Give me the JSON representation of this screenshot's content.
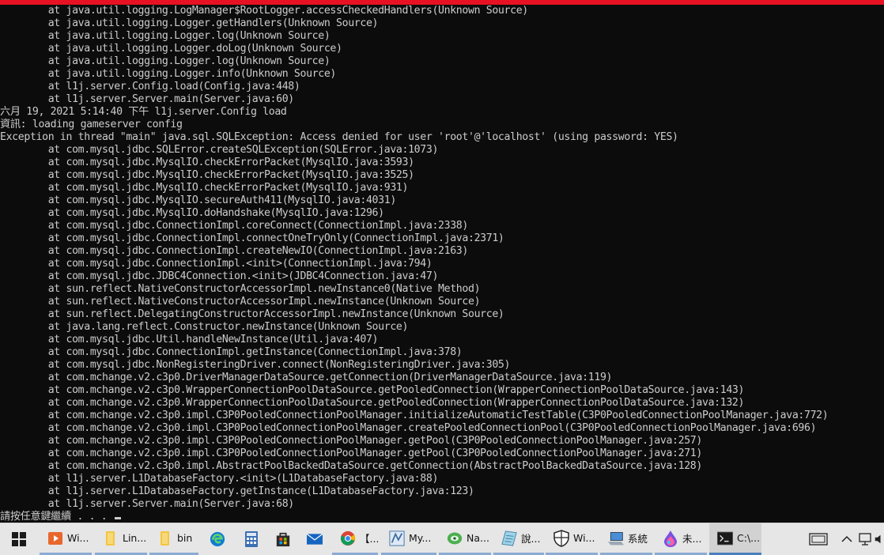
{
  "console": {
    "lines": [
      "        at java.util.logging.LogManager$RootLogger.accessCheckedHandlers(Unknown Source)",
      "        at java.util.logging.Logger.getHandlers(Unknown Source)",
      "        at java.util.logging.Logger.log(Unknown Source)",
      "        at java.util.logging.Logger.doLog(Unknown Source)",
      "        at java.util.logging.Logger.log(Unknown Source)",
      "        at java.util.logging.Logger.info(Unknown Source)",
      "        at l1j.server.Config.load(Config.java:448)",
      "        at l1j.server.Server.main(Server.java:60)",
      "六月 19, 2021 5:14:40 下午 l1j.server.Config load",
      "資訊: loading gameserver config",
      "Exception in thread \"main\" java.sql.SQLException: Access denied for user 'root'@'localhost' (using password: YES)",
      "        at com.mysql.jdbc.SQLError.createSQLException(SQLError.java:1073)",
      "        at com.mysql.jdbc.MysqlIO.checkErrorPacket(MysqlIO.java:3593)",
      "        at com.mysql.jdbc.MysqlIO.checkErrorPacket(MysqlIO.java:3525)",
      "        at com.mysql.jdbc.MysqlIO.checkErrorPacket(MysqlIO.java:931)",
      "        at com.mysql.jdbc.MysqlIO.secureAuth411(MysqlIO.java:4031)",
      "        at com.mysql.jdbc.MysqlIO.doHandshake(MysqlIO.java:1296)",
      "        at com.mysql.jdbc.ConnectionImpl.coreConnect(ConnectionImpl.java:2338)",
      "        at com.mysql.jdbc.ConnectionImpl.connectOneTryOnly(ConnectionImpl.java:2371)",
      "        at com.mysql.jdbc.ConnectionImpl.createNewIO(ConnectionImpl.java:2163)",
      "        at com.mysql.jdbc.ConnectionImpl.<init>(ConnectionImpl.java:794)",
      "        at com.mysql.jdbc.JDBC4Connection.<init>(JDBC4Connection.java:47)",
      "        at sun.reflect.NativeConstructorAccessorImpl.newInstance0(Native Method)",
      "        at sun.reflect.NativeConstructorAccessorImpl.newInstance(Unknown Source)",
      "        at sun.reflect.DelegatingConstructorAccessorImpl.newInstance(Unknown Source)",
      "        at java.lang.reflect.Constructor.newInstance(Unknown Source)",
      "        at com.mysql.jdbc.Util.handleNewInstance(Util.java:407)",
      "        at com.mysql.jdbc.ConnectionImpl.getInstance(ConnectionImpl.java:378)",
      "        at com.mysql.jdbc.NonRegisteringDriver.connect(NonRegisteringDriver.java:305)",
      "        at com.mchange.v2.c3p0.DriverManagerDataSource.getConnection(DriverManagerDataSource.java:119)",
      "        at com.mchange.v2.c3p0.WrapperConnectionPoolDataSource.getPooledConnection(WrapperConnectionPoolDataSource.java:143)",
      "        at com.mchange.v2.c3p0.WrapperConnectionPoolDataSource.getPooledConnection(WrapperConnectionPoolDataSource.java:132)",
      "        at com.mchange.v2.c3p0.impl.C3P0PooledConnectionPoolManager.initializeAutomaticTestTable(C3P0PooledConnectionPoolManager.java:772)",
      "        at com.mchange.v2.c3p0.impl.C3P0PooledConnectionPoolManager.createPooledConnectionPool(C3P0PooledConnectionPoolManager.java:696)",
      "        at com.mchange.v2.c3p0.impl.C3P0PooledConnectionPoolManager.getPool(C3P0PooledConnectionPoolManager.java:257)",
      "        at com.mchange.v2.c3p0.impl.C3P0PooledConnectionPoolManager.getPool(C3P0PooledConnectionPoolManager.java:271)",
      "        at com.mchange.v2.c3p0.impl.AbstractPoolBackedDataSource.getConnection(AbstractPoolBackedDataSource.java:128)",
      "        at l1j.server.L1DatabaseFactory.<init>(L1DatabaseFactory.java:88)",
      "        at l1j.server.L1DatabaseFactory.getInstance(L1DatabaseFactory.java:123)",
      "        at l1j.server.Server.main(Server.java:68)"
    ],
    "prompt": "請按任意鍵繼續 . . . "
  },
  "taskbar": {
    "items": [
      {
        "label": "Wi...",
        "icon": "media-player-icon"
      },
      {
        "label": "Lin...",
        "icon": "folder-icon"
      },
      {
        "label": "bin",
        "icon": "folder-icon"
      },
      {
        "label": "",
        "icon": "edge-icon"
      },
      {
        "label": "",
        "icon": "calculator-icon"
      },
      {
        "label": "",
        "icon": "store-icon"
      },
      {
        "label": "",
        "icon": "mail-icon"
      },
      {
        "label": "【...",
        "icon": "chrome-icon"
      },
      {
        "label": "My...",
        "icon": "mysql-workbench-icon"
      },
      {
        "label": "Na...",
        "icon": "navicat-icon"
      },
      {
        "label": "說...",
        "icon": "notepad-icon"
      },
      {
        "label": "Wi...",
        "icon": "shield-icon"
      },
      {
        "label": "系統",
        "icon": "system-icon"
      },
      {
        "label": "未...",
        "icon": "paint-icon"
      },
      {
        "label": "C:\\...",
        "icon": "cmd-icon"
      }
    ]
  },
  "colors": {
    "titlebar": "#e81123",
    "console_bg": "#0c0c0c",
    "console_text": "#cccccc",
    "taskbar_bg": "#e6e6e6",
    "active_underline": "#4a7fbd"
  }
}
